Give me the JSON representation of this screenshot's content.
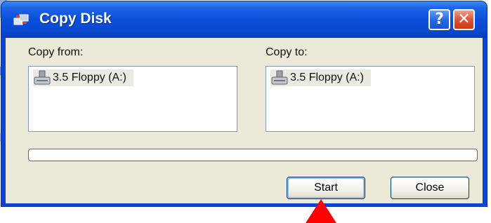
{
  "window": {
    "title": "Copy Disk",
    "help_glyph": "?",
    "close_glyph": "✕"
  },
  "copy_from": {
    "label": "Copy from:",
    "items": [
      {
        "label": "3.5 Floppy (A:)",
        "icon": "floppy-drive-icon"
      }
    ]
  },
  "copy_to": {
    "label": "Copy to:",
    "items": [
      {
        "label": "3.5 Floppy (A:)",
        "icon": "floppy-drive-icon"
      }
    ]
  },
  "progress": {
    "fraction": 0
  },
  "buttons": {
    "start": "Start",
    "close": "Close"
  },
  "colors": {
    "titlebar": "#0b4fd9",
    "dialog_face": "#ece9d8",
    "pointer_arrow": "#ff0000"
  }
}
